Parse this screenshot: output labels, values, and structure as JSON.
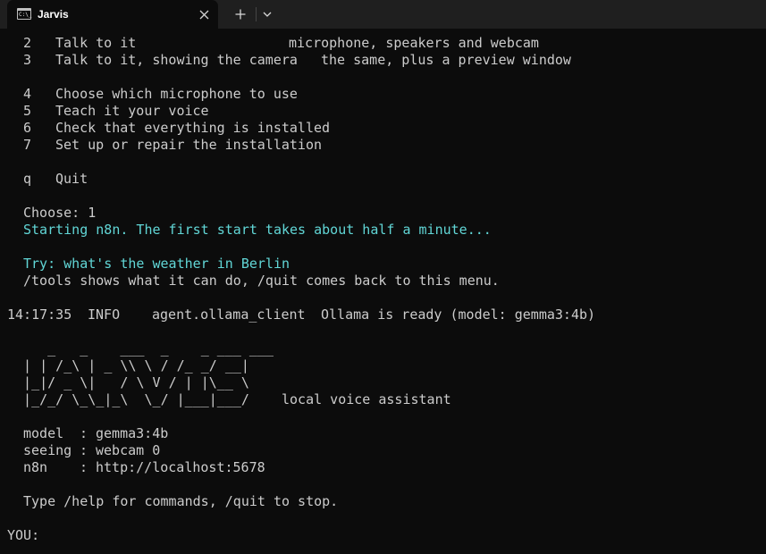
{
  "window": {
    "tab_title": "Jarvis",
    "tab_icon": "terminal-icon",
    "tab_icon_glyph": "C:\\_",
    "close_icon": "close-icon",
    "new_tab_icon": "plus-icon",
    "dropdown_icon": "chevron-down-icon"
  },
  "colors": {
    "background": "#0c0c0c",
    "text": "#cccccc",
    "accent_cyan": "#61d6d6",
    "tabbar": "#1f1f1f"
  },
  "terminal": {
    "menu": [
      {
        "key": "2",
        "label": "Talk to it",
        "description": "microphone, speakers and webcam"
      },
      {
        "key": "3",
        "label": "Talk to it, showing the camera",
        "description": "the same, plus a preview window"
      },
      {
        "key": "4",
        "label": "Choose which microphone to use"
      },
      {
        "key": "5",
        "label": "Teach it your voice"
      },
      {
        "key": "6",
        "label": "Check that everything is installed"
      },
      {
        "key": "7",
        "label": "Set up or repair the installation"
      },
      {
        "key": "q",
        "label": "Quit"
      }
    ],
    "choose_prompt": "Choose: 1",
    "starting_message": "Starting n8n. The first start takes about half a minute...",
    "try_hint": "Try: what's the weather in Berlin",
    "tools_hint": "/tools shows what it can do, /quit comes back to this menu.",
    "log_line": {
      "time": "14:17:35",
      "level": "INFO",
      "source": "agent.ollama_client",
      "message": "Ollama is ready (model: gemma3:4b)"
    },
    "ascii_banner": [
      "     _   _    ___  _    _ ___ ___",
      "  | | /_\\ | _ \\\\ \\ / /_ _/ __|",
      "  |_|/ _ \\|   / \\ V / | |\\__ \\",
      "  |_/_/ \\_\\_|_\\  \\_/ |___|___/"
    ],
    "banner_tagline": "local voice assistant",
    "info": [
      {
        "key": "model",
        "value": "gemma3:4b"
      },
      {
        "key": "seeing",
        "value": "webcam 0"
      },
      {
        "key": "n8n",
        "value": "http://localhost:5678"
      }
    ],
    "help_hint": "Type /help for commands, /quit to stop.",
    "input_prompt": "YOU:"
  }
}
